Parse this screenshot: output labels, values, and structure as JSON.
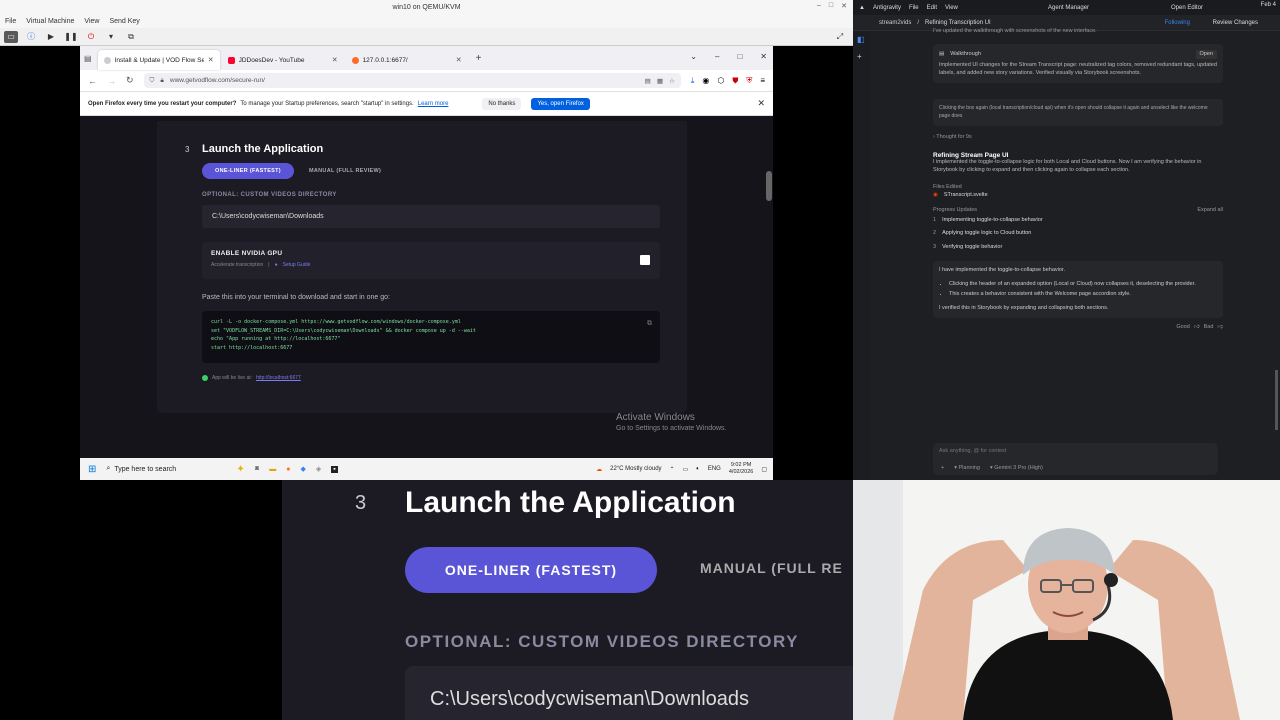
{
  "qemu": {
    "title": "win10 on QEMU/KVM",
    "menu": [
      "File",
      "Virtual Machine",
      "View",
      "Send Key"
    ]
  },
  "firefox": {
    "tabs": [
      {
        "label": "Install & Update | VOD Flow Secure",
        "color": "#e0e0e0"
      },
      {
        "label": "JDDoesDev - YouTube",
        "color": "#ff0033"
      },
      {
        "label": "127.0.0.1:6677/",
        "color": "#ff6a2a"
      }
    ],
    "url": "www.getvodflow.com/secure-run/",
    "notif_prefix": "Open Firefox every time you restart your computer?",
    "notif_text": " To manage your Startup preferences, search \"startup\" in settings.",
    "learn_more": "Learn more",
    "no_thanks": "No thanks",
    "yes_open": "Yes, open Firefox"
  },
  "page": {
    "step_number": "3",
    "step_title": "Launch the Application",
    "tab_oneliner": "ONE-LINER (FASTEST)",
    "tab_manual": "MANUAL (FULL REVIEW)",
    "optional_label": "OPTIONAL: CUSTOM VIDEOS DIRECTORY",
    "dir_value": "C:\\Users\\codycwiseman\\Downloads",
    "gpu_title": "ENABLE NVIDIA GPU",
    "gpu_sub": "Accelerate transcription",
    "gpu_guide": "Setup Guide",
    "paste_text": "Paste this into your terminal to download and start in one go:",
    "code": [
      "curl -L -o docker-compose.yml https://www.getvodflow.com/windows/docker-compose.yml",
      "set \"VODFLOW_STREAMS_DIR=C:\\Users\\codycwiseman\\Downloads\" && docker compose up -d --wait",
      "echo \"App running at http://localhost:6677\"",
      "start http://localhost:6677"
    ],
    "live_text": "App will be live at:",
    "live_link": "http://localhost:6677"
  },
  "windows": {
    "activate_title": "Activate Windows",
    "activate_sub": "Go to Settings to activate Windows.",
    "search_placeholder": "Type here to search",
    "weather": "22°C  Mostly cloudy",
    "lang": "ENG",
    "time": "9:02 PM",
    "date": "4/02/2026"
  },
  "ide": {
    "menu": [
      "Antigravity",
      "File",
      "Edit",
      "View"
    ],
    "agent_manager": "Agent Manager",
    "open_editor": "Open Editor",
    "date": "Feb 4",
    "breadcrumb_a": "stream2vids",
    "breadcrumb_b": "Refining Transcription UI",
    "following": "Following",
    "review_changes": "Review Changes",
    "prev_line": "I've updated the walkthrough with screenshots of the new interface.",
    "walkthrough_label": "Walkthrough",
    "walkthrough_open": "Open",
    "walkthrough_text": "Implemented UI changes for the Stream Transcript page: neutralized tag colors, removed redundant tags, updated labels, and added new story variations. Verified visually via Storybook screenshots.",
    "user_msg": "Clicking the box again (local transcription/cloud api) when it's open should collapse it again and unselect like the welcome page does",
    "thought": "Thought for 9s",
    "task_title": "Refining Stream Page UI",
    "task_text": "I implemented the toggle-to-collapse logic for both Local and Cloud buttons. Now I am verifying the behavior in Storybook by clicking to expand and then clicking again to collapse each section.",
    "files_edited": "Files Edited",
    "file": "STranscript.svelte",
    "progress": "Progress Updates",
    "expand_all": "Expand all",
    "steps": [
      "Implementing toggle-to-collapse behavior",
      "Applying toggle logic to Cloud button",
      "Verifying toggle behavior"
    ],
    "summary_head": "I have implemented the toggle-to-collapse behavior.",
    "bullets": [
      "Clicking the header of an expanded option (Local or Cloud) now collapses it, deselecting the provider.",
      "This creates a behavior consistent with the Welcome page accordion style."
    ],
    "summary_tail": "I verified this in Storybook by expanding and collapsing both sections.",
    "feedback": "Good",
    "feedback_bad": "Bad",
    "input_placeholder": "Ask anything, @ for context",
    "mode": "Planning",
    "model": "Gemini 3 Pro (High)"
  },
  "zoom": {
    "step_number": "3",
    "step_title": "Launch the Application",
    "tab_oneliner": "ONE-LINER (FASTEST)",
    "tab_manual": "MANUAL (FULL RE",
    "optional_label": "OPTIONAL: CUSTOM VIDEOS DIRECTORY",
    "dir_value": "C:\\Users\\codycwiseman\\Downloads"
  }
}
